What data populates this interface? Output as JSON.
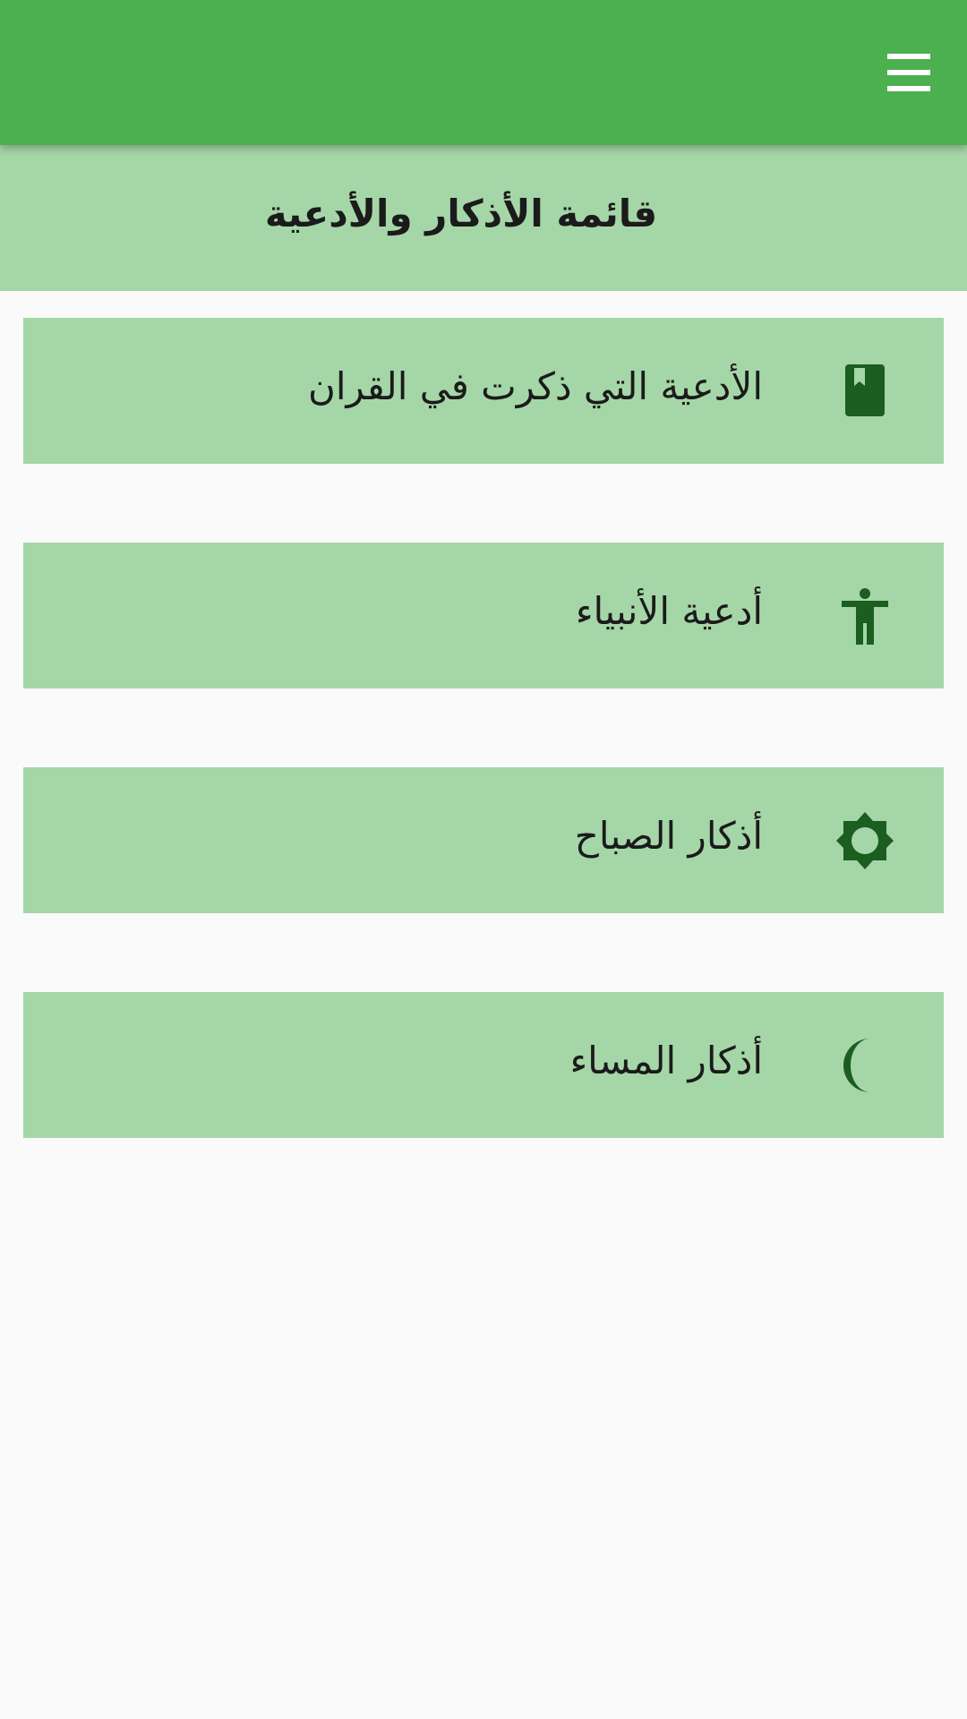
{
  "header": {
    "section_title": "قائمة الأذكار والأدعية"
  },
  "colors": {
    "app_bar": "#4caf50",
    "item_background": "#a5d6a7",
    "icon": "#1b5e20",
    "page_background": "#fafafa"
  },
  "menu_items": [
    {
      "label": "الأدعية التي ذكرت في القران",
      "icon": "book-icon"
    },
    {
      "label": "أدعية الأنبياء",
      "icon": "person-icon"
    },
    {
      "label": "أذكار الصباح",
      "icon": "sun-icon"
    },
    {
      "label": "أذكار المساء",
      "icon": "moon-icon"
    }
  ]
}
